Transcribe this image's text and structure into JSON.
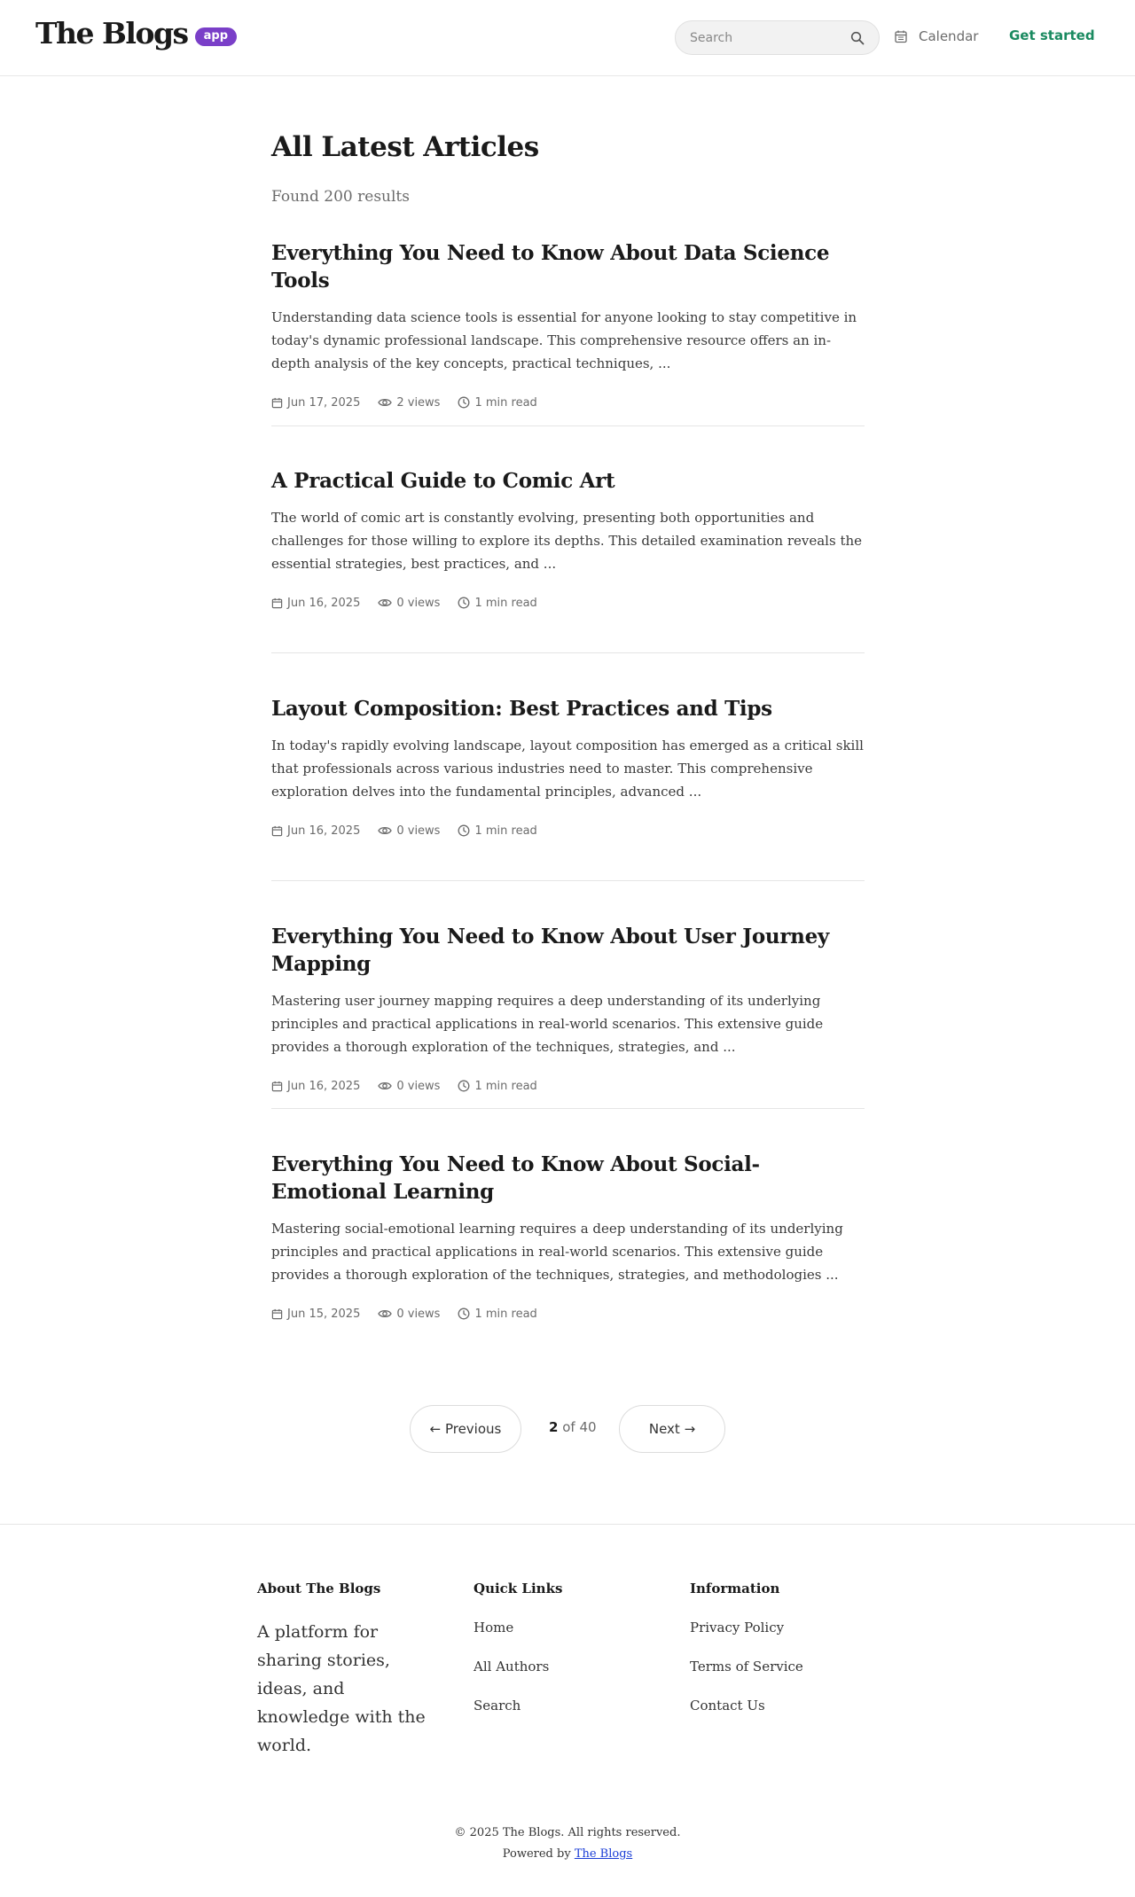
{
  "header": {
    "logo": "The Blogs",
    "badge": "app",
    "search_placeholder": "Search",
    "calendar_label": "Calendar",
    "cta_label": "Get started"
  },
  "main": {
    "title": "All Latest Articles",
    "results": "Found 200 results",
    "articles": [
      {
        "title": "Everything You Need to Know About Data Science Tools",
        "excerpt": "Understanding data science tools is essential for anyone looking to stay competitive in today's dynamic professional landscape. This comprehensive resource offers an in-depth analysis of the key concepts, practical techniques, ...",
        "date": "Jun 17, 2025",
        "views": "2 views",
        "read_time": "1 min read"
      },
      {
        "title": "A Practical Guide to Comic Art",
        "excerpt": "The world of comic art is constantly evolving, presenting both opportunities and challenges for those willing to explore its depths. This detailed examination reveals the essential strategies, best practices, and ...",
        "date": "Jun 16, 2025",
        "views": "0 views",
        "read_time": "1 min read"
      },
      {
        "title": "Layout Composition: Best Practices and Tips",
        "excerpt": "In today's rapidly evolving landscape, layout composition has emerged as a critical skill that professionals across various industries need to master. This comprehensive exploration delves into the fundamental principles, advanced ...",
        "date": "Jun 16, 2025",
        "views": "0 views",
        "read_time": "1 min read"
      },
      {
        "title": "Everything You Need to Know About User Journey Mapping",
        "excerpt": "Mastering user journey mapping requires a deep understanding of its underlying principles and practical applications in real-world scenarios. This extensive guide provides a thorough exploration of the techniques, strategies, and ...",
        "date": "Jun 16, 2025",
        "views": "0 views",
        "read_time": "1 min read"
      },
      {
        "title": "Everything You Need to Know About Social-Emotional Learning",
        "excerpt": "Mastering social-emotional learning requires a deep understanding of its underlying principles and practical applications in real-world scenarios. This extensive guide provides a thorough exploration of the techniques, strategies, and methodologies ...",
        "date": "Jun 15, 2025",
        "views": "0 views",
        "read_time": "1 min read"
      }
    ]
  },
  "pagination": {
    "prev_label": "← Previous",
    "current": "2",
    "of_label": "of 40",
    "next_label": "Next →"
  },
  "footer": {
    "about_heading": "About The Blogs",
    "about_text": "A platform for sharing stories, ideas, and knowledge with the world.",
    "quick_links_heading": "Quick Links",
    "quick_links": [
      "Home",
      "All Authors",
      "Search"
    ],
    "info_heading": "Information",
    "info_links": [
      "Privacy Policy",
      "Terms of Service",
      "Contact Us"
    ],
    "copyright": "© 2025 The Blogs. All rights reserved.",
    "powered_prefix": "Powered by",
    "powered_link": "The Blogs"
  }
}
